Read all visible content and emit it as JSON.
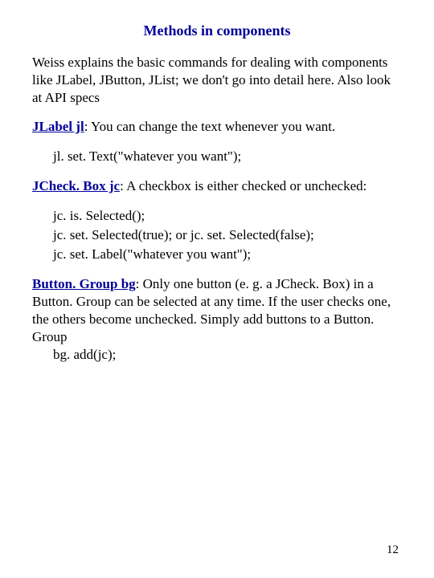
{
  "title": "Methods in components",
  "intro": "Weiss explains the basic commands for dealing with components like JLabel, JButton, JList; we don't go into detail here. Also look at API specs",
  "jlabel": {
    "heading": "JLabel jl",
    "text": ": You can change the text whenever you want.",
    "code": "jl. set. Text(\"whatever you want\");"
  },
  "jcheckbox": {
    "heading": "JCheck. Box jc",
    "text": ": A checkbox is either checked or unchecked:",
    "code1": "jc. is. Selected();",
    "code2": "jc. set. Selected(true); or jc. set. Selected(false);",
    "code3": "jc. set. Label(\"whatever you want\");"
  },
  "buttongroup": {
    "heading": "Button. Group bg",
    "text": ": Only one button (e. g. a JCheck. Box) in a Button. Group can be selected at any time. If the user checks one, the others become unchecked. Simply add buttons to a Button. Group",
    "code": "bg. add(jc);"
  },
  "pagenum": "12"
}
